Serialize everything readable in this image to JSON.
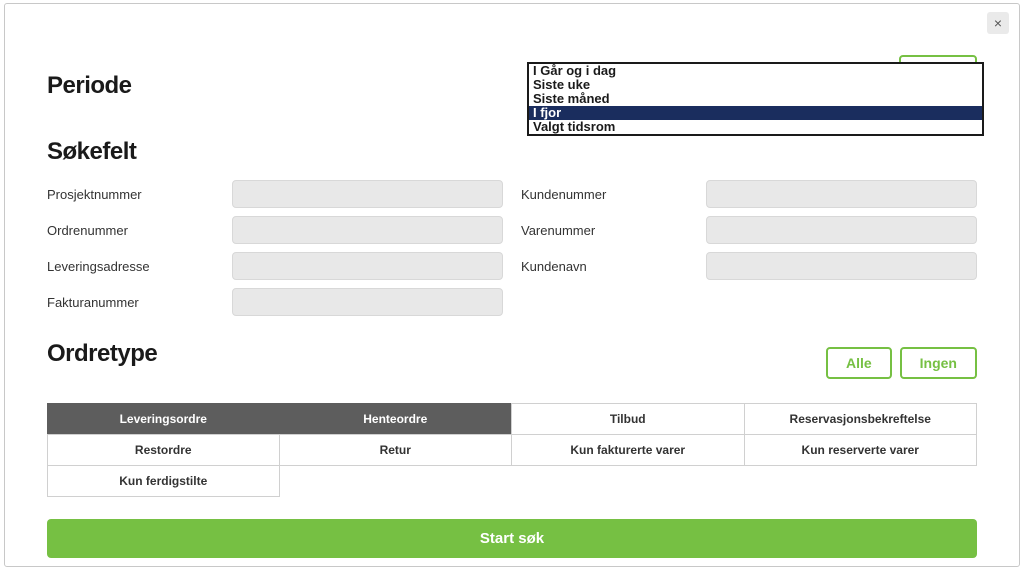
{
  "modal": {
    "close_label": "×"
  },
  "periode": {
    "heading": "Periode",
    "dropdown": {
      "items": [
        "I Går og i dag",
        "Siste uke",
        "Siste måned",
        "I fjor",
        "Valgt tidsrom"
      ],
      "selected_index": 3
    }
  },
  "sokefelt": {
    "heading": "Søkefelt",
    "fields": {
      "prosjektnummer": {
        "label": "Prosjektnummer",
        "value": ""
      },
      "kundenummer": {
        "label": "Kundenummer",
        "value": ""
      },
      "ordrenummer": {
        "label": "Ordrenummer",
        "value": ""
      },
      "varenummer": {
        "label": "Varenummer",
        "value": ""
      },
      "leveringsadresse": {
        "label": "Leveringsadresse",
        "value": ""
      },
      "kundenavn": {
        "label": "Kundenavn",
        "value": ""
      },
      "fakturanummer": {
        "label": "Fakturanummer",
        "value": ""
      }
    }
  },
  "ordretype": {
    "heading": "Ordretype",
    "alle_label": "Alle",
    "ingen_label": "Ingen",
    "types": [
      {
        "label": "Leveringsordre",
        "active": true
      },
      {
        "label": "Henteordre",
        "active": true
      },
      {
        "label": "Tilbud",
        "active": false
      },
      {
        "label": "Reservasjonsbekreftelse",
        "active": false
      },
      {
        "label": "Restordre",
        "active": false
      },
      {
        "label": "Retur",
        "active": false
      },
      {
        "label": "Kun fakturerte varer",
        "active": false
      },
      {
        "label": "Kun reserverte varer",
        "active": false
      },
      {
        "label": "Kun ferdigstilte",
        "active": false
      }
    ]
  },
  "actions": {
    "start_sok": "Start søk"
  }
}
